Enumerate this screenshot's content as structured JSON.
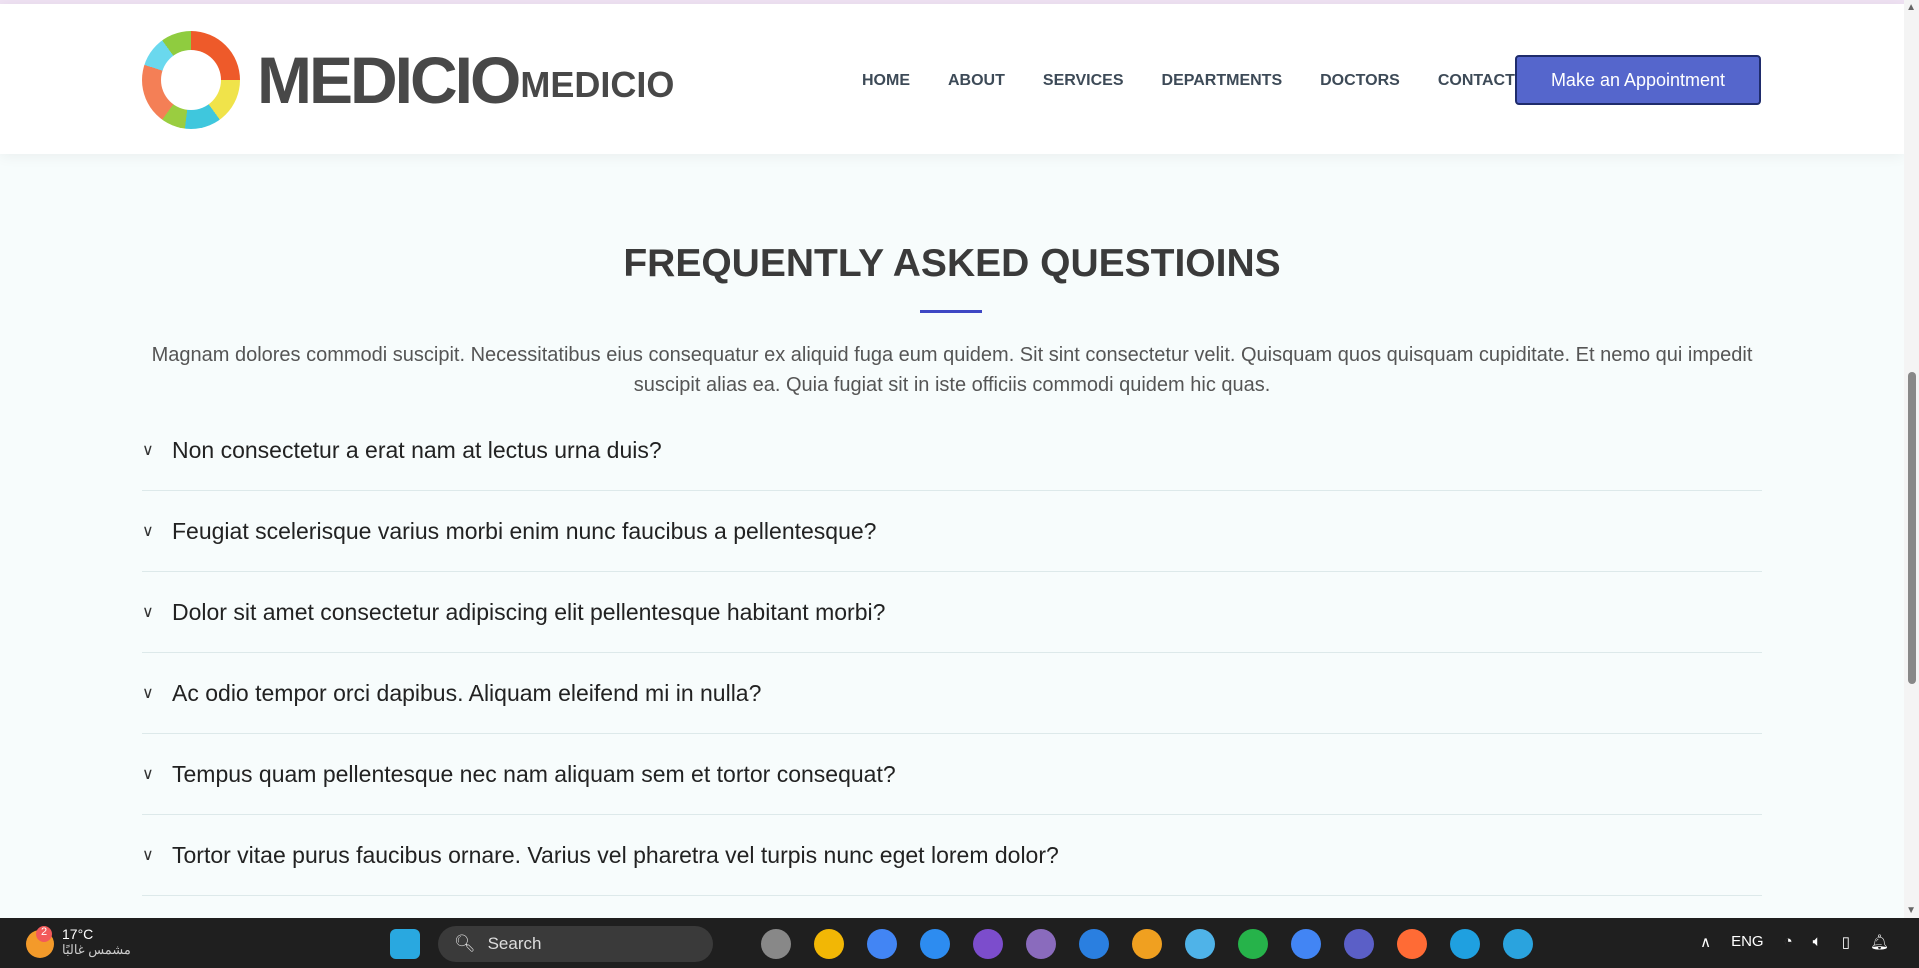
{
  "header": {
    "logo_text": "MEDICIO",
    "logo_text_small": "MEDICIO",
    "nav": [
      "HOME",
      "ABOUT",
      "SERVICES",
      "DEPARTMENTS",
      "DOCTORS",
      "CONTACT"
    ],
    "cta": "Make an Appointment"
  },
  "faq": {
    "title": "FREQUENTLY ASKED QUESTIOINS",
    "description": "Magnam dolores commodi suscipit. Necessitatibus eius consequatur ex aliquid fuga eum quidem. Sit sint consectetur velit. Quisquam quos quisquam cupiditate. Et nemo qui impedit suscipit alias ea. Quia fugiat sit in iste officiis commodi quidem hic quas.",
    "items": [
      "Non consectetur a erat nam at lectus urna duis?",
      "Feugiat scelerisque varius morbi enim nunc faucibus a pellentesque?",
      "Dolor sit amet consectetur adipiscing elit pellentesque habitant morbi?",
      "Ac odio tempor orci dapibus. Aliquam eleifend mi in nulla?",
      "Tempus quam pellentesque nec nam aliquam sem et tortor consequat?",
      "Tortor vitae purus faucibus ornare. Varius vel pharetra vel turpis nunc eget lorem dolor?"
    ]
  },
  "taskbar": {
    "temp": "17°C",
    "weather": "مشمس غالبًا",
    "badge": "2",
    "search": "Search",
    "lang": "ENG",
    "app_colors": [
      "#29a8e0",
      "#888",
      "#f2b705",
      "#4285f4",
      "#2d8cf0",
      "#7c4dcc",
      "#8a6bbd",
      "#2a7fe0",
      "#f0a020",
      "#4fb3e8",
      "#26b34a",
      "#4285f4",
      "#5b5fc7",
      "#ff6b35",
      "#1fa0e0",
      "#2aa3de"
    ]
  }
}
